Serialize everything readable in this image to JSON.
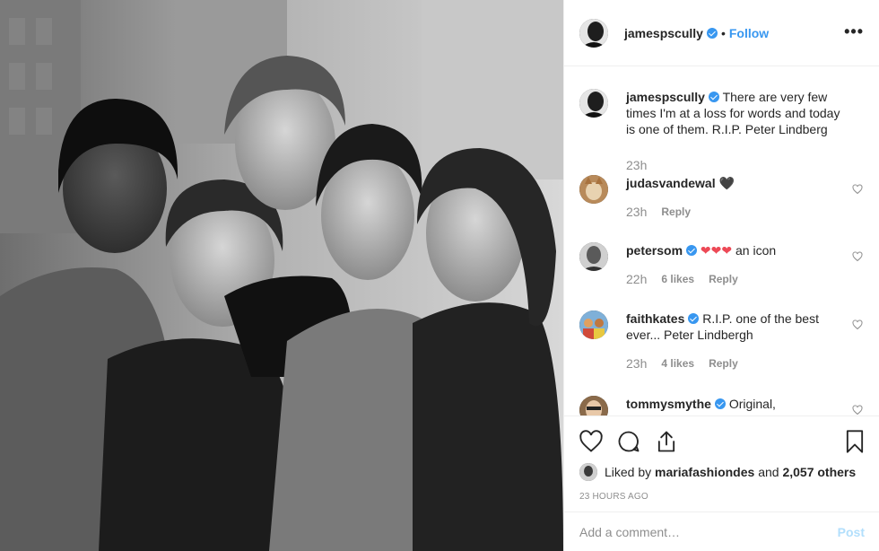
{
  "post": {
    "photo_alt": "Black and white photograph of five women",
    "author": "jamespscully",
    "separator": "•",
    "follow_label": "Follow",
    "more_label": "•••"
  },
  "comments": [
    {
      "username": "jamespscully",
      "text": "There are very few times I'm at a loss for words and today is one of them. R.I.P. Peter Lindberg",
      "time": "23h",
      "likes": "",
      "reply": ""
    },
    {
      "username": "judasvandewal",
      "text": "🖤",
      "time": "23h",
      "likes": "",
      "reply": "Reply"
    },
    {
      "username": "petersom",
      "text": "an icon",
      "emoji": "❤❤❤",
      "time": "22h",
      "likes": "6 likes",
      "reply": "Reply"
    },
    {
      "username": "faithkates",
      "text": "R.I.P. one of the best ever... Peter Lindbergh",
      "time": "23h",
      "likes": "4 likes",
      "reply": "Reply"
    },
    {
      "username": "tommysmythe",
      "text": "Original,"
    }
  ],
  "likes": {
    "prefix": "Liked by ",
    "user": "mariafashiondes",
    "middle": " and ",
    "count": "2,057 others"
  },
  "timestamp": "23 HOURS AGO",
  "add_comment": {
    "placeholder": "Add a comment…",
    "post_label": "Post"
  },
  "colors": {
    "accent": "#3897f0",
    "muted": "#8e8e8e",
    "heart_red": "#ed4956"
  }
}
